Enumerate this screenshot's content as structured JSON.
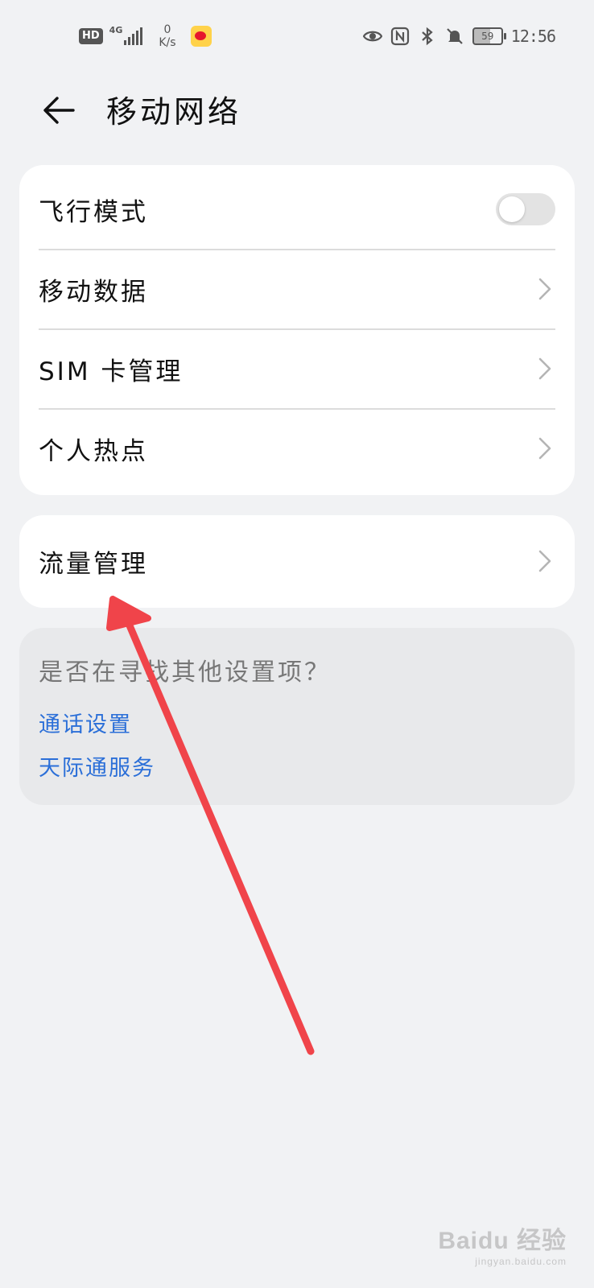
{
  "status_bar": {
    "hd_label": "HD",
    "network_type": "4G",
    "speed_value": "0",
    "speed_unit": "K/s",
    "battery_level": "59",
    "time": "12:56",
    "icons": [
      "hd-icon",
      "signal-icon",
      "weibo-icon",
      "eye-icon",
      "nfc-icon",
      "bluetooth-icon",
      "mute-bell-icon",
      "battery-icon"
    ]
  },
  "header": {
    "back_icon": "arrow-left-icon",
    "title": "移动网络"
  },
  "main_card": {
    "items": [
      {
        "label": "飞行模式",
        "control": "toggle",
        "toggle_on": false
      },
      {
        "label": "移动数据",
        "control": "chevron"
      },
      {
        "label": "SIM 卡管理",
        "control": "chevron"
      },
      {
        "label": "个人热点",
        "control": "chevron"
      }
    ]
  },
  "traffic_card": {
    "label": "流量管理",
    "control": "chevron"
  },
  "suggestions": {
    "title": "是否在寻找其他设置项？",
    "links": [
      "通话设置",
      "天际通服务"
    ]
  },
  "annotation": {
    "color": "#f0444a"
  },
  "watermark": {
    "main": "Baidu 经验",
    "sub": "jingyan.baidu.com"
  },
  "colors": {
    "background": "#f1f2f4",
    "card": "#ffffff",
    "link": "#2b6fd8",
    "suggest_bg": "#e8e9eb"
  }
}
